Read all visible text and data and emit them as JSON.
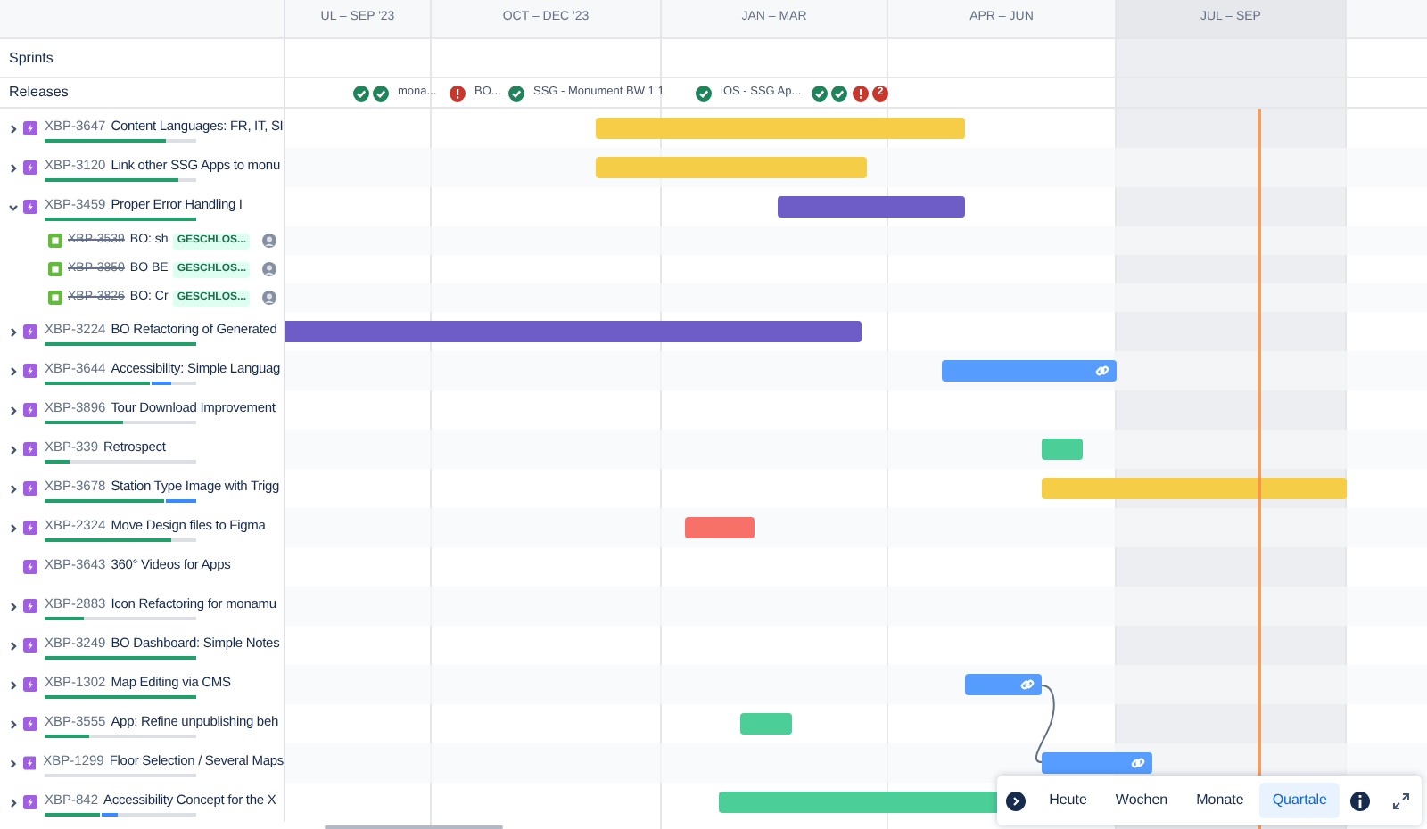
{
  "quarters": [
    {
      "label": "UL – SEP '23",
      "current": false
    },
    {
      "label": "OCT – DEC '23",
      "current": false
    },
    {
      "label": "JAN – MAR",
      "current": false
    },
    {
      "label": "APR – JUN",
      "current": false
    },
    {
      "label": "JUL – SEP",
      "current": true
    }
  ],
  "sprints": {
    "label": "Sprints"
  },
  "releases": {
    "label": "Releases",
    "markers": [
      {
        "icons": [
          {
            "kind": "released"
          },
          {
            "kind": "released"
          }
        ],
        "label": "mona..."
      },
      {
        "icons": [
          {
            "kind": "overdue"
          }
        ],
        "label": "BO..."
      },
      {
        "icons": [
          {
            "kind": "released"
          }
        ],
        "label": "SSG - Monument BW 1.1"
      },
      {
        "icons": [
          {
            "kind": "released"
          }
        ],
        "label": "iOS - SSG Ap..."
      },
      {
        "icons": [
          {
            "kind": "released"
          },
          {
            "kind": "released"
          }
        ]
      },
      {
        "icons": [
          {
            "kind": "overdue"
          }
        ],
        "count": "2"
      }
    ]
  },
  "items": [
    {
      "key": "XBP-3647",
      "summary": "Content Languages: FR, IT, SI",
      "expandable": true,
      "expanded": false,
      "done": {
        "level": 0.8
      },
      "bar": {
        "color": "#f5cd47",
        "link_icon": false
      }
    },
    {
      "key": "XBP-3120",
      "summary": "Link other SSG Apps to monu",
      "expandable": true,
      "expanded": false,
      "done": {
        "level": 0.88
      },
      "bar": {
        "color": "#f5cd47",
        "link_icon": false
      }
    },
    {
      "key": "XBP-3459",
      "summary": "Proper Error Handling I",
      "expandable": true,
      "expanded": true,
      "done": {
        "level": 1
      },
      "bar": {
        "color": "#6e5dc6",
        "link_icon": false
      },
      "children": [
        {
          "key": "XBP-3539",
          "summary": "BO: sh",
          "status": "GESCHLOS...",
          "resolved": true
        },
        {
          "key": "XBP-3850",
          "summary": "BO BE",
          "status": "GESCHLOS...",
          "resolved": true
        },
        {
          "key": "XBP-3826",
          "summary": "BO: Cr",
          "status": "GESCHLOS...",
          "resolved": true
        }
      ]
    },
    {
      "key": "XBP-3224",
      "summary": "BO Refactoring of Generated",
      "expandable": true,
      "expanded": false,
      "done": {
        "level": 1
      },
      "bar": {
        "color": "#6e5dc6",
        "link_icon": false
      }
    },
    {
      "key": "XBP-3644",
      "summary": "Accessibility: Simple Languag",
      "expandable": true,
      "expanded": false,
      "done": {
        "level": 0.7
      },
      "started": {
        "level": 0.84
      },
      "bar": {
        "color": "#579dff",
        "link_icon": true
      }
    },
    {
      "key": "XBP-3896",
      "summary": "Tour Download Improvement",
      "expandable": true,
      "expanded": false,
      "done": {
        "level": 0.52
      }
    },
    {
      "key": "XBP-339",
      "summary": "Retrospect",
      "expandable": true,
      "expanded": false,
      "done": {
        "level": 0.16
      },
      "bar": {
        "color": "#4bce97",
        "link_icon": false
      }
    },
    {
      "key": "XBP-3678",
      "summary": "Station Type Image with Trigg",
      "expandable": true,
      "expanded": false,
      "done": {
        "level": 0.8
      },
      "started": {
        "level": 1
      },
      "bar": {
        "color": "#f5cd47",
        "link_icon": false
      }
    },
    {
      "key": "XBP-2324",
      "summary": "Move Design files to Figma",
      "expandable": true,
      "expanded": false,
      "done": {
        "level": 0.84
      },
      "bar": {
        "color": "#f87168",
        "link_icon": false
      }
    },
    {
      "key": "XBP-3643",
      "summary": "360° Videos for Apps",
      "expandable": false
    },
    {
      "key": "XBP-2883",
      "summary": "Icon Refactoring for monamu",
      "expandable": true,
      "expanded": false,
      "done": {
        "level": 0.26
      }
    },
    {
      "key": "XBP-3249",
      "summary": "BO Dashboard: Simple Notes",
      "expandable": true,
      "expanded": false,
      "done": {
        "level": 1
      }
    },
    {
      "key": "XBP-1302",
      "summary": "Map Editing via CMS",
      "expandable": true,
      "expanded": false,
      "done": {
        "level": 1
      },
      "bar": {
        "color": "#579dff",
        "link_icon": true,
        "dependency_start": true
      }
    },
    {
      "key": "XBP-3555",
      "summary": "App: Refine unpublishing beh",
      "expandable": true,
      "expanded": false,
      "done": {
        "level": 0.29
      },
      "bar": {
        "color": "#4bce97",
        "link_icon": false
      }
    },
    {
      "key": "XBP-1299",
      "summary": "Floor Selection / Several Maps",
      "expandable": true,
      "expanded": false,
      "done": {
        "level": 0
      },
      "bar": {
        "color": "#579dff",
        "link_icon": true,
        "dependency_end": true
      }
    },
    {
      "key": "XBP-842",
      "summary": "Accessibility Concept for the X",
      "expandable": true,
      "expanded": false,
      "done": {
        "level": 0.38
      },
      "started": {
        "level": 0.48
      },
      "bar": {
        "color": "#4bce97",
        "link_icon": false
      }
    }
  ],
  "toolbar": {
    "buttons": [
      {
        "label": "Heute",
        "selected": false
      },
      {
        "label": "Wochen",
        "selected": false
      },
      {
        "label": "Monate",
        "selected": false
      },
      {
        "label": "Quartale",
        "selected": true
      }
    ]
  }
}
